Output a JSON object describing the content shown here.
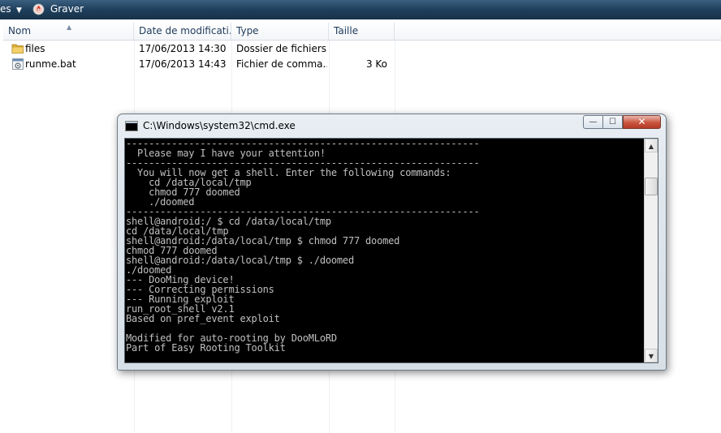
{
  "toolbar": {
    "organize_label": "es",
    "burn_label": "Graver",
    "burn_icon": "burn-disc-icon"
  },
  "columns": {
    "name": "Nom",
    "date": "Date de modificati...",
    "type": "Type",
    "size": "Taille"
  },
  "files": [
    {
      "icon": "folder-icon",
      "name": "files",
      "date": "17/06/2013 14:30",
      "type": "Dossier de fichiers",
      "size": ""
    },
    {
      "icon": "batch-file-icon",
      "name": "runme.bat",
      "date": "17/06/2013 14:43",
      "type": "Fichier de comma...",
      "size": "3 Ko"
    }
  ],
  "cmd": {
    "title": "C:\\Windows\\system32\\cmd.exe",
    "buttons": {
      "minimize": "—",
      "maximize": "☐",
      "close": "✕"
    },
    "console_text": "--------------------------------------------------------------\n  Please may I have your attention!\n--------------------------------------------------------------\n  You will now get a shell. Enter the following commands:\n    cd /data/local/tmp\n    chmod 777 doomed\n    ./doomed\n--------------------------------------------------------------\nshell@android:/ $ cd /data/local/tmp\ncd /data/local/tmp\nshell@android:/data/local/tmp $ chmod 777 doomed\nchmod 777 doomed\nshell@android:/data/local/tmp $ ./doomed\n./doomed\n--- DooMing device!\n--- Correcting permissions\n--- Running exploit\nrun_root_shell v2.1\nBased on pref_event exploit\n\nModified for auto-rooting by DooMLoRD\nPart of Easy Rooting Toolkit"
  },
  "colors": {
    "toolbar_bg": "#1f3f5c",
    "console_bg": "#000000",
    "console_fg": "#c0c0c0",
    "close_button": "#c9553f"
  }
}
